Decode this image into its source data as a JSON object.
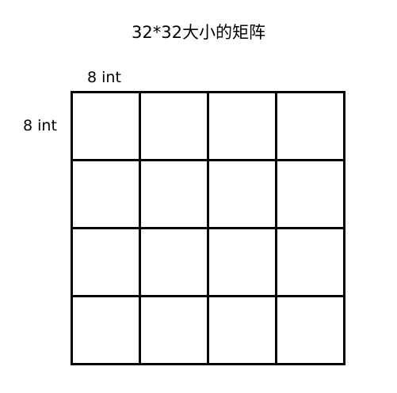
{
  "diagram": {
    "title": "32*32大小的矩阵",
    "column_label": "8 int",
    "row_label": "8 int",
    "grid": {
      "rows": 4,
      "cols": 4,
      "line_color": "#000000"
    }
  }
}
